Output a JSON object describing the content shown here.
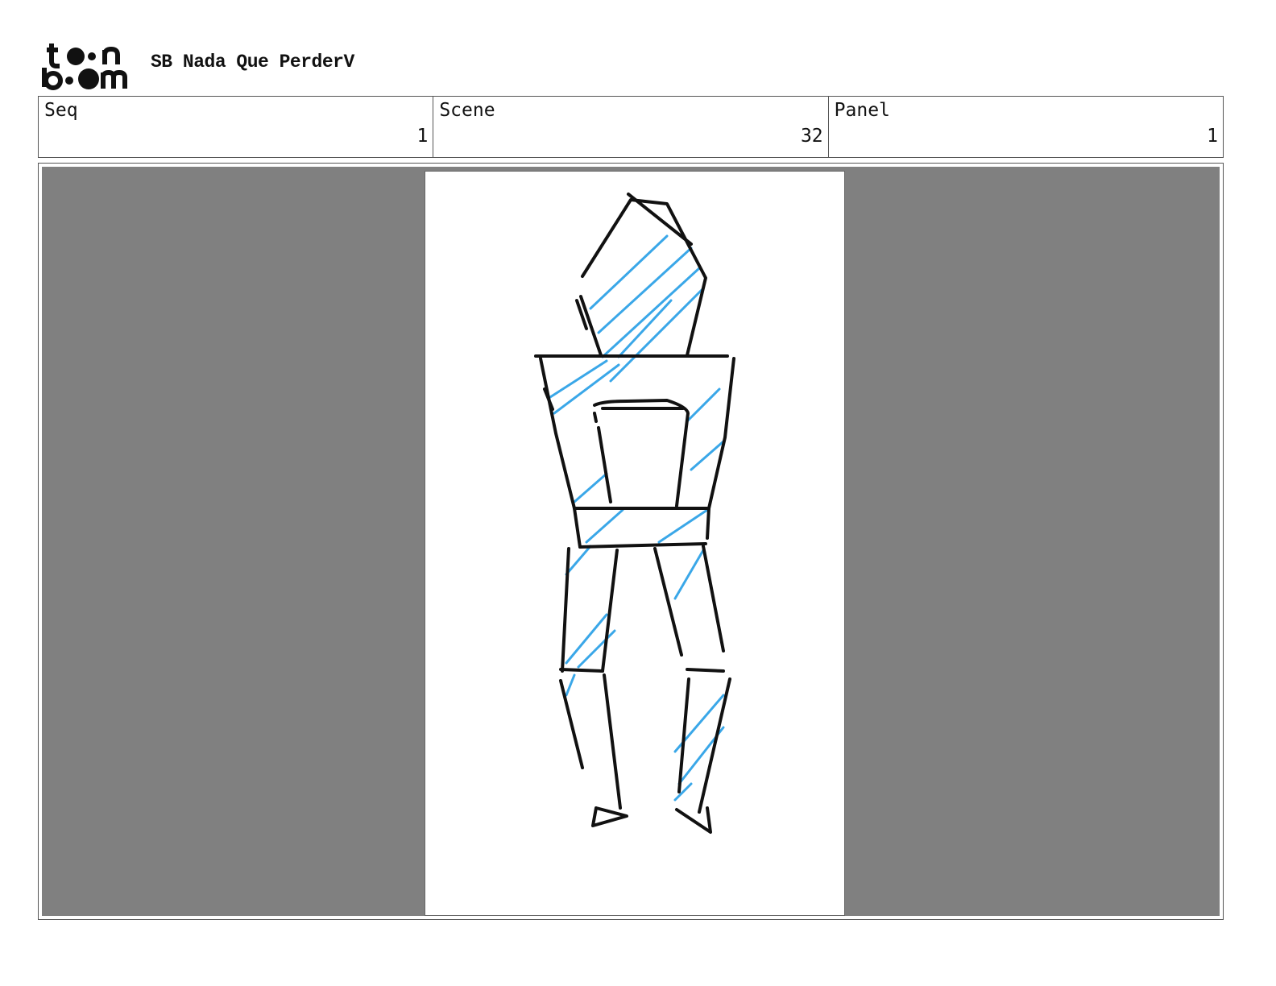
{
  "header": {
    "logo_text": "toon boom",
    "project_title": "SB Nada Que PerderV"
  },
  "info": {
    "seq_label": "Seq",
    "seq_value": "1",
    "scene_label": "Scene",
    "scene_value": "32",
    "panel_label": "Panel",
    "panel_value": "1"
  },
  "panel": {
    "background_color": "#808080",
    "sketch_line_color": "#111111",
    "sketch_shade_color": "#3aa7e8"
  }
}
